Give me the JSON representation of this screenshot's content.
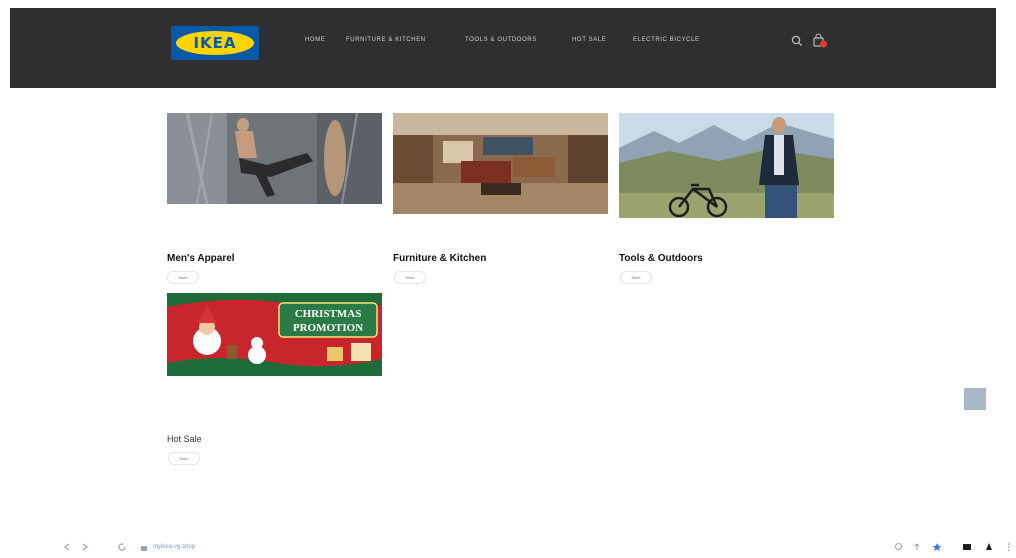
{
  "header": {
    "logo_text": "IKEA",
    "nav": [
      "HOME",
      "FURNITURE & KITCHEN",
      "TOOLS & OUTDOORS",
      "HOT SALE",
      "ELECTRIC BICYCLE"
    ]
  },
  "categories": [
    {
      "title": "Men's Apparel",
      "button": "More"
    },
    {
      "title": "Furniture & Kitchen",
      "button": "More"
    },
    {
      "title": "Tools & Outdoors",
      "button": "More"
    }
  ],
  "promo": {
    "line1": "CHRISTMAS",
    "line2": "PROMOTION"
  },
  "hot_sale": {
    "title": "Hot Sale",
    "button": "More"
  },
  "browser": {
    "url": "myikea-vg.shop"
  },
  "colors": {
    "navbar": "#2f2f32",
    "ikea_blue": "#0a58a8",
    "ikea_yellow": "#ffd400",
    "cart_red": "#e03a2e",
    "promo_red": "#c9252d"
  }
}
